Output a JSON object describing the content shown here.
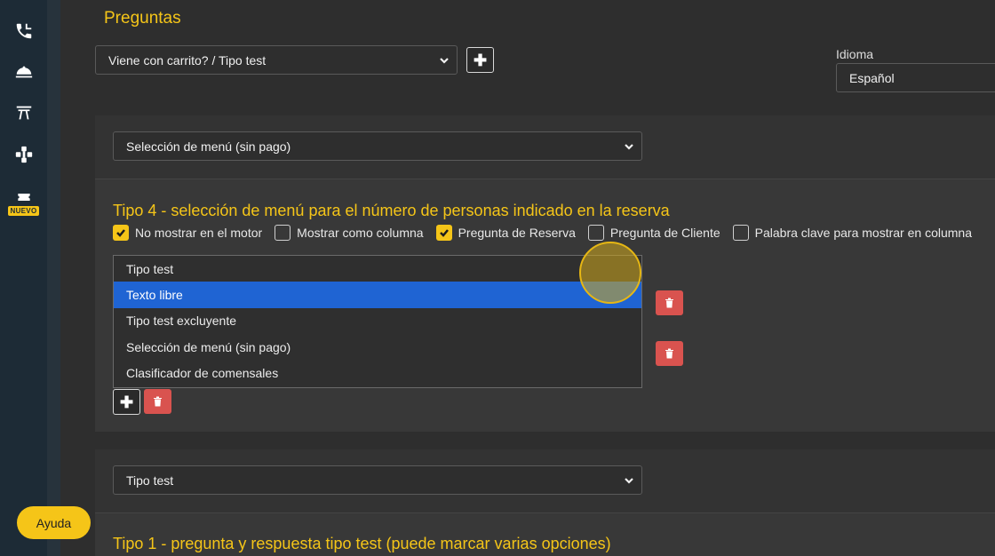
{
  "sidebar": {
    "items": [
      {
        "icon": "phone-icon"
      },
      {
        "icon": "cloche-icon"
      },
      {
        "icon": "table-icon"
      },
      {
        "icon": "puzzle-icon"
      },
      {
        "icon": "ticket-icon",
        "badge": "NUEVO"
      }
    ]
  },
  "page": {
    "title": "Preguntas",
    "question_select": "Viene con carrito? / Tipo test",
    "language_label": "Idioma",
    "language_value": "Español"
  },
  "card1": {
    "type_select": "Selección de menú (sin pago)",
    "title": "Tipo 4 - selección de menú para el número de personas indicado en la reserva",
    "checkboxes": [
      {
        "label": "No mostrar en el motor",
        "checked": true
      },
      {
        "label": "Mostrar como columna",
        "checked": false
      },
      {
        "label": "Pregunta de Reserva",
        "checked": true
      },
      {
        "label": "Pregunta de Cliente",
        "checked": false
      },
      {
        "label": "Palabra clave para mostrar en columna",
        "checked": false
      }
    ],
    "dropdown_options": [
      {
        "label": "Tipo test",
        "selected": false
      },
      {
        "label": "Texto libre",
        "selected": true
      },
      {
        "label": "Tipo test excluyente",
        "selected": false
      },
      {
        "label": "Selección de menú (sin pago)",
        "selected": false
      },
      {
        "label": "Clasificador de comensales",
        "selected": false
      }
    ]
  },
  "card2": {
    "type_select": "Tipo test",
    "title": "Tipo 1 - pregunta y respuesta tipo test (puede marcar varias opciones)"
  },
  "help": {
    "label": "Ayuda"
  },
  "colors": {
    "accent": "#f5c518",
    "highlight": "#1f64d3",
    "danger": "#d9534f",
    "sidebar": "#1d2b36"
  }
}
